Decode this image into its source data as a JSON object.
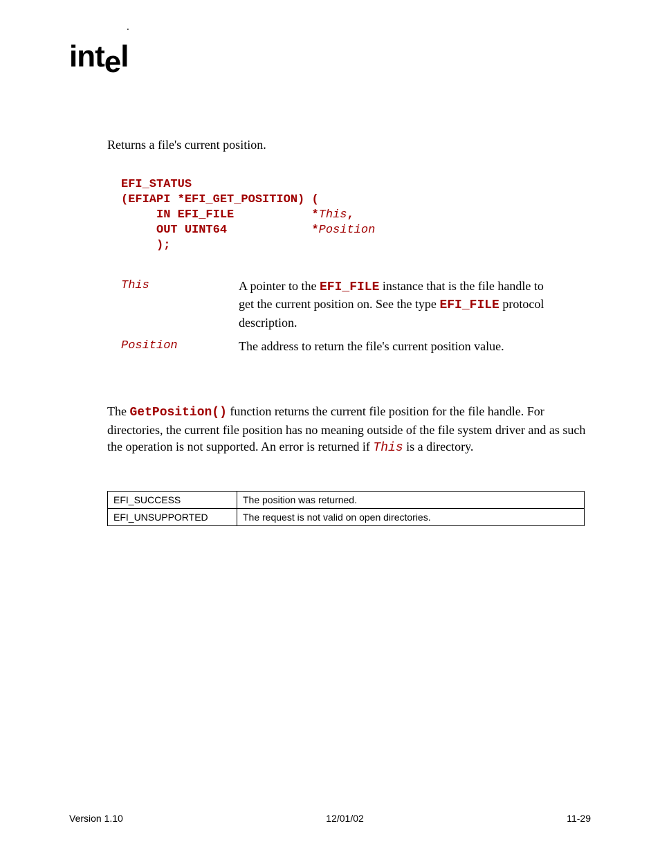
{
  "logo": "intel",
  "summary": "Returns a file's current position.",
  "prototype": {
    "line1": "EFI_STATUS",
    "line2": "(EFIAPI *EFI_GET_POSITION) (",
    "arg1_kw": "     IN EFI_FILE",
    "arg1_sep": "           *",
    "arg1_name": "This",
    "arg1_trail": ",",
    "arg2_kw": "     OUT UINT64",
    "arg2_sep": "            *",
    "arg2_name": "Position",
    "line5": "     );"
  },
  "params": [
    {
      "name": "This",
      "desc_prefix": "A pointer to the ",
      "desc_mono1": "EFI_FILE",
      "desc_mid": " instance that is the file handle to get the current position on.  See the type ",
      "desc_mono2": "EFI_FILE",
      "desc_suffix": " protocol description."
    },
    {
      "name": "Position",
      "desc_prefix": "The address to return the file's current position value.",
      "desc_mono1": "",
      "desc_mid": "",
      "desc_mono2": "",
      "desc_suffix": ""
    }
  ],
  "description": {
    "prefix": "The ",
    "func": "GetPosition()",
    "mid1": " function returns the current file position for the file handle.  For directories, the current file position has no meaning outside of the file system driver and as such the operation is not supported.  An error is returned if ",
    "this_ref": "This",
    "suffix": " is a directory."
  },
  "status_codes": [
    {
      "code": "EFI_SUCCESS",
      "desc": "The position was returned."
    },
    {
      "code": "EFI_UNSUPPORTED",
      "desc": "The request is not valid on open directories."
    }
  ],
  "footer": {
    "left": "Version 1.10",
    "center": "12/01/02",
    "right": "11-29"
  }
}
